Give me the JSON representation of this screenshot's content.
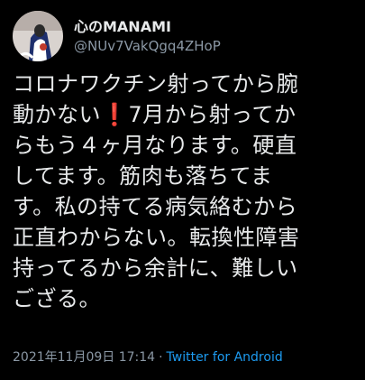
{
  "user": {
    "display_name": "心のMANAMI",
    "handle": "@NUv7VakQgq4ZHoP"
  },
  "tweet": {
    "line1": "コロナワクチン射ってから腕",
    "line2a": "動かない",
    "line2_emoji": "❗",
    "line2b": "7月から射ってか",
    "line3": "らもう４ヶ月なります。硬直",
    "line4": "してます。筋肉も落ちてま",
    "line5": "す。私の持てる病気絡むから",
    "line6": "正直わからない。転換性障害",
    "line7": "持ってるから余計に、難しい",
    "line8": "ござる。"
  },
  "meta": {
    "timestamp": "2021年11月09日 17:14",
    "separator": "·",
    "source": "Twitter for Android"
  },
  "colors": {
    "background": "#000000",
    "text": "#e7e9ea",
    "muted": "#8b98a5",
    "link": "#1d9bf0",
    "emoji": "#e0245e"
  }
}
